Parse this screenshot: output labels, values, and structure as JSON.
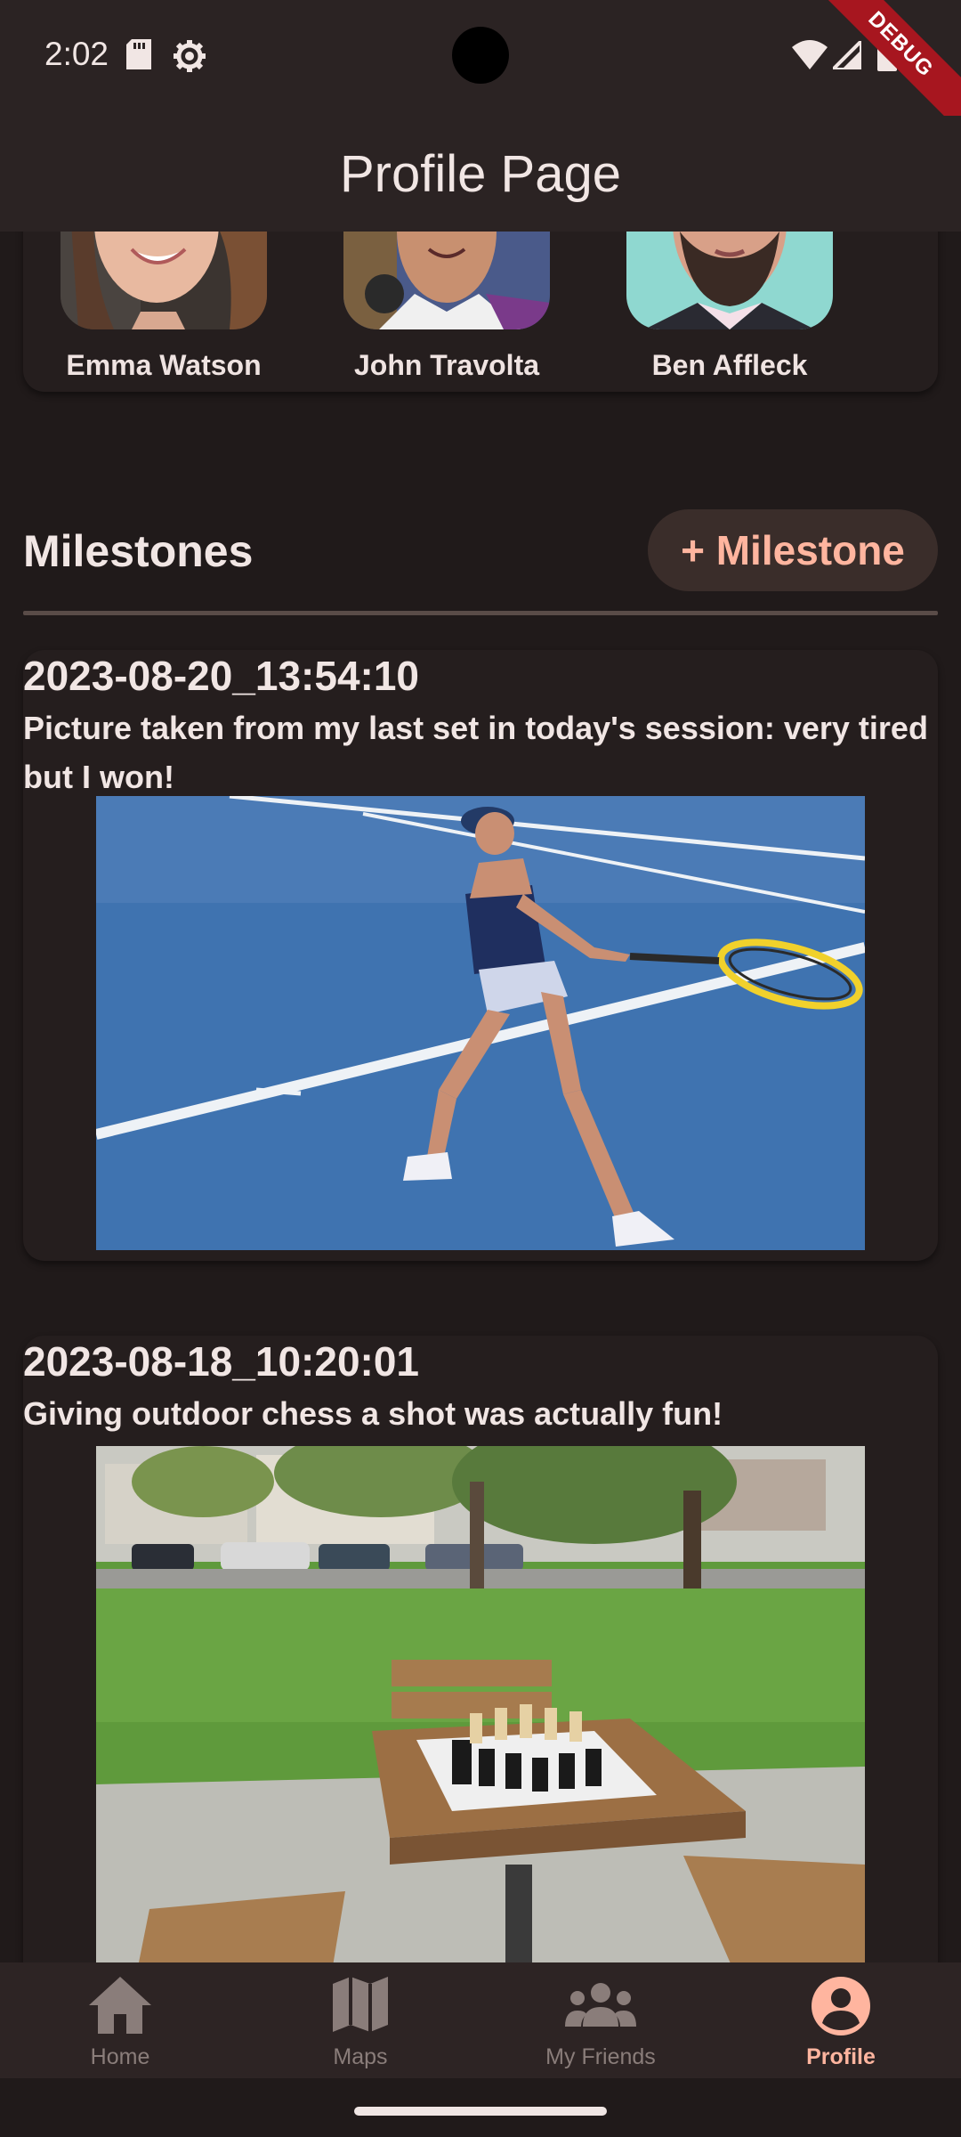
{
  "status_bar": {
    "time": "2:02",
    "icons": [
      "sd-card-icon",
      "settings-gear-icon",
      "wifi-icon",
      "cellular-signal-icon",
      "battery-icon"
    ],
    "debug_banner": "DEBUG"
  },
  "app_bar": {
    "title": "Profile Page"
  },
  "friends": [
    {
      "name": "Emma Watson"
    },
    {
      "name": "John Travolta"
    },
    {
      "name": "Ben Affleck"
    }
  ],
  "milestones_section": {
    "title": "Milestones",
    "add_button_label": "+ Milestone",
    "items": [
      {
        "date": "2023-08-20_13:54:10",
        "description": "Picture taken from my last set in today's session: very tired but I won!",
        "photo": "tennis-player-photo"
      },
      {
        "date": "2023-08-18_10:20:01",
        "description": "Giving outdoor chess a shot was actually fun!",
        "photo": "outdoor-chess-table-photo"
      }
    ]
  },
  "bottom_nav": {
    "items": [
      {
        "label": "Home",
        "icon": "home-icon"
      },
      {
        "label": "Maps",
        "icon": "map-icon"
      },
      {
        "label": "My Friends",
        "icon": "group-icon"
      },
      {
        "label": "Profile",
        "icon": "account-circle-icon",
        "active": true
      }
    ]
  },
  "colors": {
    "background": "#201a1a",
    "accent": "#ffb59f",
    "inactive": "#8a7d7a"
  }
}
